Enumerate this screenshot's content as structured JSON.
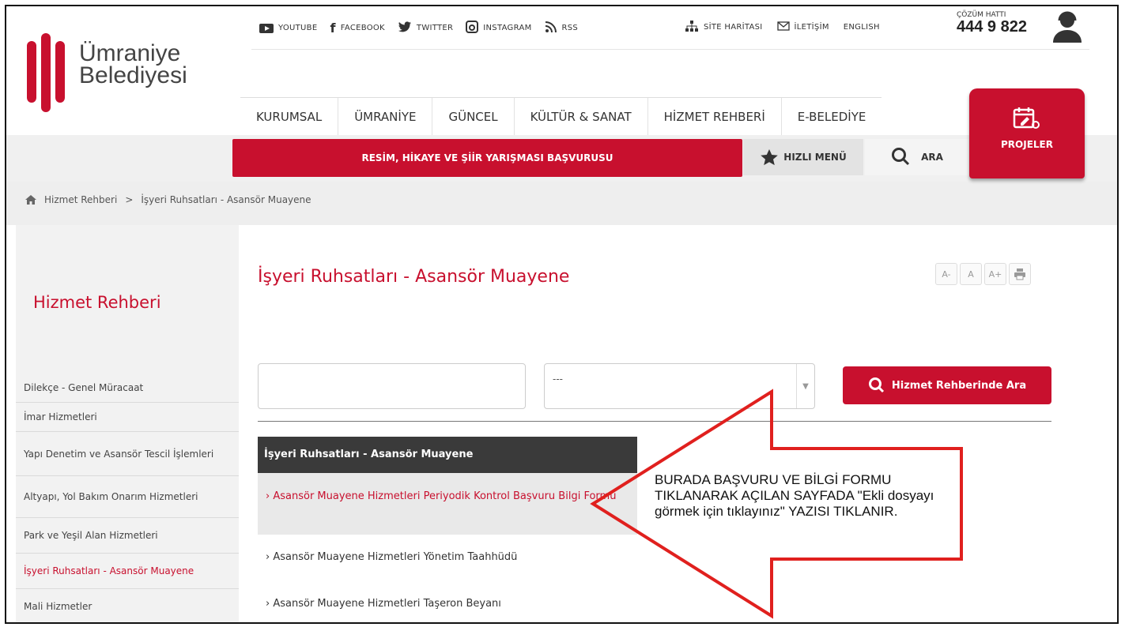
{
  "brand": {
    "name_line1": "Ümraniye",
    "name_line2": "Belediyesi",
    "accent": "#c8102e"
  },
  "social": [
    "YOUTUBE",
    "FACEBOOK",
    "TWITTER",
    "INSTAGRAM",
    "RSS"
  ],
  "util": {
    "sitemap": "SİTE HARİTASI",
    "contact": "İLETİŞİM",
    "english": "ENGLISH"
  },
  "hotline": {
    "label": "ÇÖZÜM HATTI",
    "number": "444 9 822"
  },
  "nav": [
    "KURUMSAL",
    "ÜMRANİYE",
    "GÜNCEL",
    "KÜLTÜR & SANAT",
    "HİZMET REHBERİ",
    "E-BELEDİYE"
  ],
  "projeler": "PROJELER",
  "announcement": "RESİM, HİKAYE VE ŞİİR YARIŞMASI BAŞVURUSU",
  "quick_menu": "HIZLI MENÜ",
  "search_label": "ARA",
  "breadcrumb": {
    "sep": ">",
    "items": [
      "Hizmet Rehberi",
      "İşyeri Ruhsatları - Asansör Muayene"
    ]
  },
  "sidebar": {
    "title": "Hizmet Rehberi",
    "items": [
      "Dilekçe - Genel Müracaat",
      "İmar Hizmetleri",
      "Yapı Denetim ve Asansör Tescil İşlemleri",
      "Altyapı, Yol Bakım Onarım Hizmetleri",
      "Park ve Yeşil Alan Hizmetleri",
      "İşyeri Ruhsatları - Asansör Muayene",
      "Mali Hizmetler"
    ],
    "active_index": 5
  },
  "main": {
    "title": "İşyeri Ruhsatları - Asansör Muayene",
    "font_buttons": [
      "A-",
      "A",
      "A+"
    ],
    "select_value": "---",
    "search_button": "Hizmet Rehberinde Ara",
    "box_title": "İşyeri Ruhsatları - Asansör Muayene",
    "box_items": [
      "Asansör Muayene Hizmetleri Periyodik Kontrol Başvuru Bilgi Formu",
      "Asansör Muayene Hizmetleri Yönetim Taahhüdü",
      "Asansör Muayene Hizmetleri Taşeron Beyanı"
    ]
  },
  "annotation": {
    "text": "BURADA BAŞVURU VE BİLGİ FORMU TIKLANARAK AÇILAN SAYFADA \"Ekli dosyayı görmek için tıklayınız\" YAZISI TIKLANIR.",
    "color": "#e0201e"
  }
}
